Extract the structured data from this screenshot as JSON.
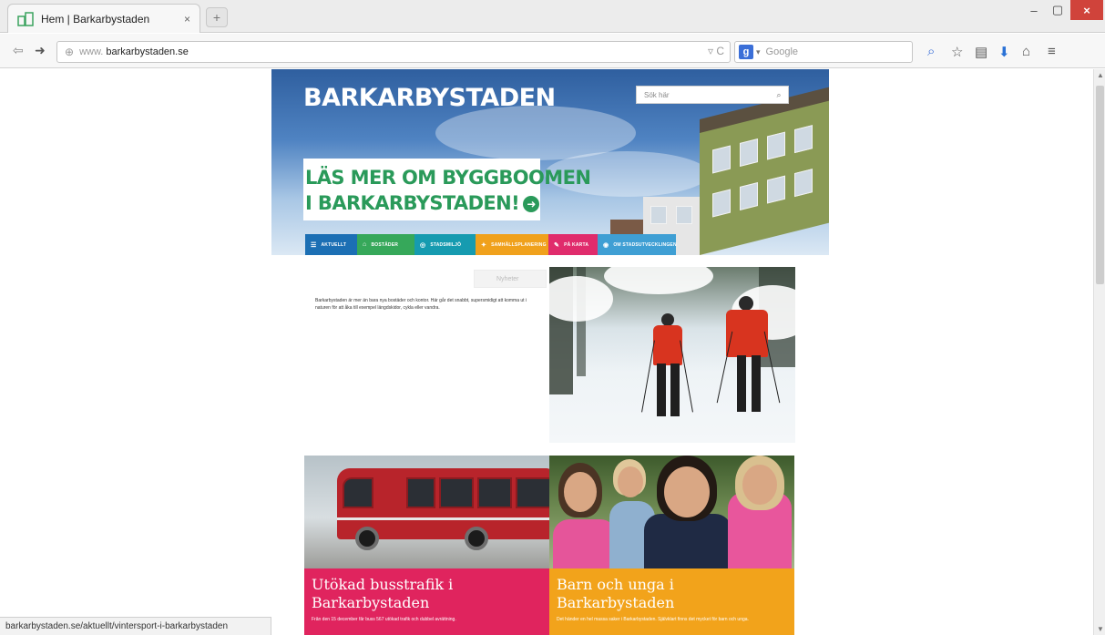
{
  "browser": {
    "tab_title": "Hem | Barkarbystaden",
    "tab_close": "×",
    "new_tab": "+",
    "window_controls": {
      "minimize": "–",
      "maximize": "▢",
      "close": "×"
    },
    "url_prefix": "www.",
    "url_domain": "barkarbystaden.se",
    "url_tools": "▿ C",
    "search_engine": "g",
    "search_placeholder": "Google",
    "icons": [
      "back-icon",
      "forward-icon",
      "globe-icon",
      "search-icon",
      "star-icon",
      "clipboard-icon",
      "download-icon",
      "home-icon",
      "menu-icon"
    ],
    "status_url": "barkarbystaden.se/aktuellt/vintersport-i-barkarbystaden"
  },
  "site": {
    "logo": "BARKARBYSTADEN",
    "search_placeholder": "Sök här",
    "promo_line1": "LÄS MER OM BYGGBOOMEN",
    "promo_line2": "I BARKARBYSTADEN!",
    "nav": [
      {
        "label": "AKTUELLT",
        "icon": "☰",
        "color": "#1c6fb4"
      },
      {
        "label": "BOSTÄDER",
        "icon": "⌂",
        "color": "#36a85a"
      },
      {
        "label": "STADSMILJÖ",
        "icon": "◎",
        "color": "#169bb0"
      },
      {
        "label": "SAMHÄLLSPLANERING",
        "icon": "✦",
        "color": "#f0a11c"
      },
      {
        "label": "PÅ KARTA",
        "icon": "✎",
        "color": "#e02c6c"
      },
      {
        "label": "OM STADSUTVECKLINGEN",
        "icon": "◉",
        "color": "#3f9fd4"
      }
    ],
    "tag_pill": "Nyheter",
    "intro": "Barkarbystaden är mer än bara nya bostäder och kontor. Här går det snabbt, supersmidigt att komma ut i naturen för att åka till exempel längdskidor, cykla eller vandra.",
    "cards": [
      {
        "title": "Utökad busstrafik i Barkarbystaden",
        "text": "Från den 15 december får buss 567 utökad trafik och dubbel avrättning."
      },
      {
        "title": "Barn och unga i Barkarbystaden",
        "text": "Det händer en hel massa saker i Barkarbystaden. Självklart finns det mycket för barn och unga."
      }
    ]
  }
}
